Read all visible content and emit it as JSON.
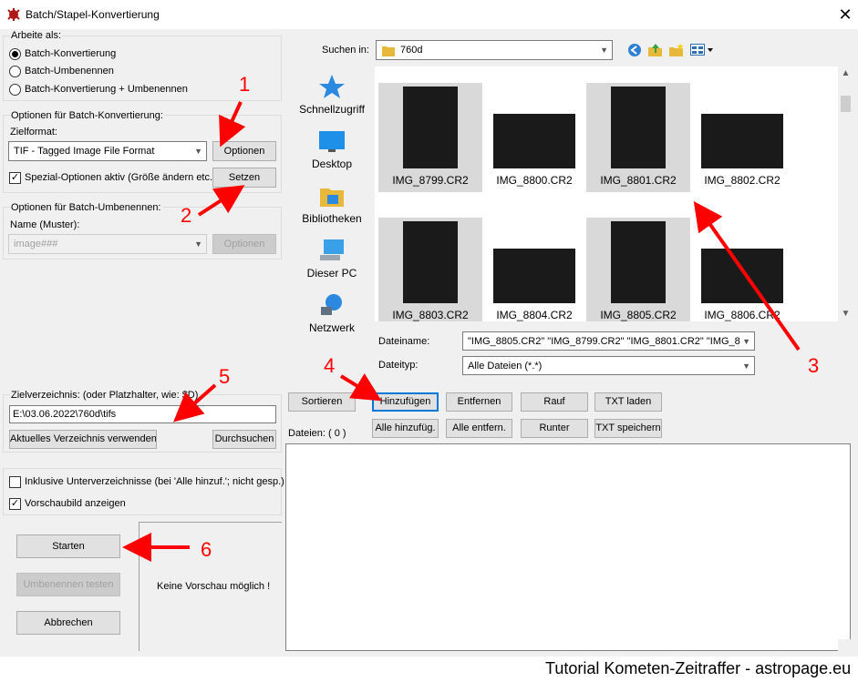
{
  "window": {
    "title": "Batch/Stapel-Konvertierung",
    "close_glyph": "✕"
  },
  "work_as": {
    "label": "Arbeite als:",
    "options": [
      {
        "label": "Batch-Konvertierung",
        "selected": true
      },
      {
        "label": "Batch-Umbenennen",
        "selected": false
      },
      {
        "label": "Batch-Konvertierung + Umbenennen",
        "selected": false
      }
    ]
  },
  "convert_options": {
    "label": "Optionen für Batch-Konvertierung:",
    "target_format_label": "Zielformat:",
    "target_format_value": "TIF - Tagged Image File Format",
    "options_button": "Optionen",
    "special_label": "Spezial-Optionen aktiv (Größe ändern etc.)",
    "special_checked": true,
    "set_button": "Setzen"
  },
  "rename_options": {
    "label": "Optionen für Batch-Umbenennen:",
    "pattern_label": "Name (Muster):",
    "pattern_value": "image###",
    "options_button": "Optionen"
  },
  "target_dir": {
    "label": "Zielverzeichnis: (oder Platzhalter, wie: $D)",
    "value": "E:\\03.06.2022\\760d\\tifs",
    "use_current_button": "Aktuelles Verzeichnis verwenden",
    "browse_button": "Durchsuchen"
  },
  "options": {
    "include_subdirs": "Inklusive Unterverzeichnisse (bei 'Alle hinzuf.'; nicht gesp.)",
    "include_subdirs_checked": false,
    "show_preview": "Vorschaubild anzeigen",
    "show_preview_checked": true
  },
  "actions": {
    "start": "Starten",
    "test_rename": "Umbenennen testen",
    "cancel": "Abbrechen"
  },
  "preview": {
    "text": "Keine Vorschau möglich !"
  },
  "browser": {
    "search_in_label": "Suchen in:",
    "folder": "760d",
    "places": [
      "Schnellzugriff",
      "Desktop",
      "Bibliotheken",
      "Dieser PC",
      "Netzwerk"
    ],
    "files": [
      {
        "name": "IMG_8799.CR2",
        "selected": true
      },
      {
        "name": "IMG_8800.CR2",
        "selected": false
      },
      {
        "name": "IMG_8801.CR2",
        "selected": true
      },
      {
        "name": "IMG_8802.CR2",
        "selected": false
      },
      {
        "name": "IMG_8803.CR2",
        "selected": true
      },
      {
        "name": "IMG_8804.CR2",
        "selected": false
      },
      {
        "name": "IMG_8805.CR2",
        "selected": true
      },
      {
        "name": "IMG_8806.CR2",
        "selected": false
      }
    ],
    "filename_label": "Dateiname:",
    "filename_value": "\"IMG_8805.CR2\" \"IMG_8799.CR2\" \"IMG_8801.CR2\" \"IMG_8",
    "filetype_label": "Dateityp:",
    "filetype_value": "Alle Dateien (*.*)"
  },
  "list_buttons": {
    "sort": "Sortieren",
    "add": "Hinzufügen",
    "remove": "Entfernen",
    "up": "Rauf",
    "load_txt": "TXT laden",
    "add_all": "Alle hinzufüg.",
    "remove_all": "Alle entfern.",
    "down": "Runter",
    "save_txt": "TXT speichern"
  },
  "files_count_label": "Dateien:   ( 0 )",
  "annotations": [
    "1",
    "2",
    "3",
    "4",
    "5",
    "6"
  ],
  "annotation_color": "#ff0000",
  "footer": "Tutorial Kometen-Zeitraffer - astropage.eu"
}
